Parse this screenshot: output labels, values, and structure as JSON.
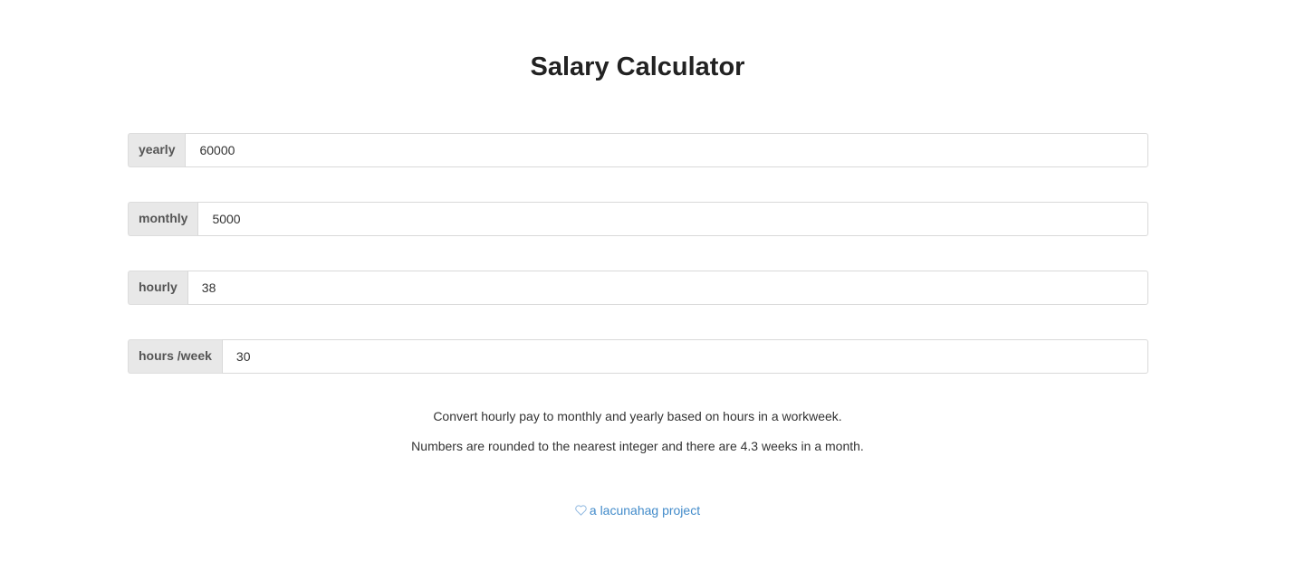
{
  "title": "Salary Calculator",
  "fields": [
    {
      "label": "yearly",
      "value": "60000"
    },
    {
      "label": "monthly",
      "value": "5000"
    },
    {
      "label": "hourly",
      "value": "38"
    },
    {
      "label": "hours /week",
      "value": "30"
    }
  ],
  "description": {
    "line1": "Convert hourly pay to monthly and yearly based on hours in a workweek.",
    "line2": "Numbers are rounded to the nearest integer and there are 4.3 weeks in a month."
  },
  "footer": {
    "icon": "heart-icon",
    "link_text": "a lacunahag project",
    "link_color": "#428bca"
  }
}
